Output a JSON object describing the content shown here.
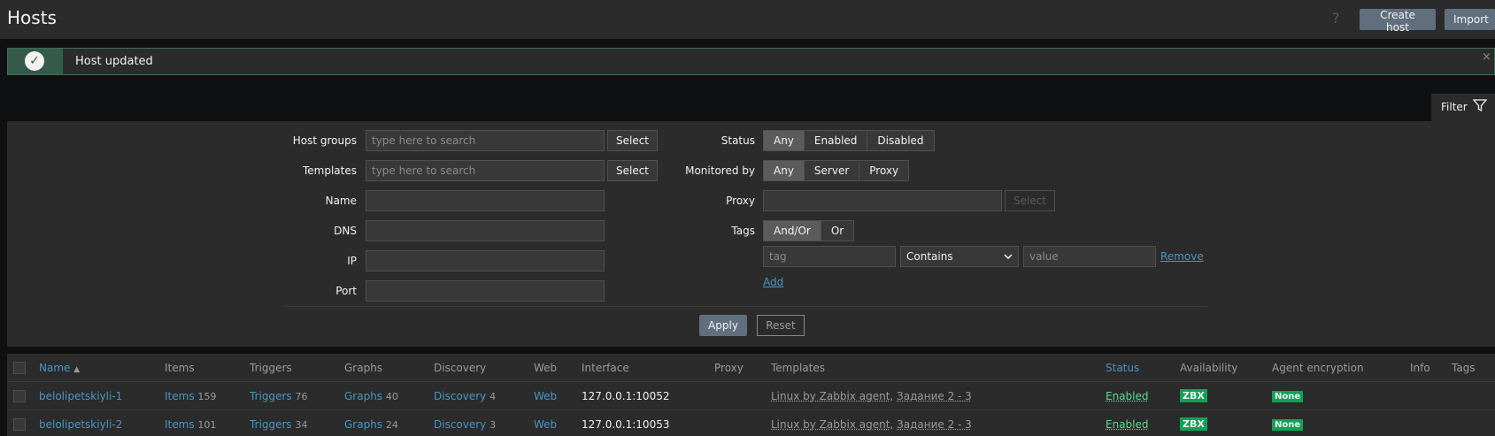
{
  "header": {
    "title": "Hosts",
    "help": "?",
    "create_host": "Create host",
    "import": "Import"
  },
  "message": {
    "text": "Host updated",
    "close": "×"
  },
  "filter": {
    "tab_label": "Filter",
    "host_groups": {
      "label": "Host groups",
      "placeholder": "type here to search",
      "button": "Select"
    },
    "templates": {
      "label": "Templates",
      "placeholder": "type here to search",
      "button": "Select"
    },
    "name_label": "Name",
    "dns_label": "DNS",
    "ip_label": "IP",
    "port_label": "Port",
    "status": {
      "label": "Status",
      "options": [
        "Any",
        "Enabled",
        "Disabled"
      ],
      "selected": "Any"
    },
    "monitored_by": {
      "label": "Monitored by",
      "options": [
        "Any",
        "Server",
        "Proxy"
      ],
      "selected": "Any"
    },
    "proxy": {
      "label": "Proxy",
      "button": "Select"
    },
    "tags": {
      "label": "Tags",
      "options": [
        "And/Or",
        "Or"
      ],
      "selected": "And/Or",
      "tag_placeholder": "tag",
      "operator": "Contains",
      "value_placeholder": "value",
      "remove": "Remove",
      "add": "Add"
    },
    "apply": "Apply",
    "reset": "Reset"
  },
  "table": {
    "columns": [
      "Name",
      "Items",
      "Triggers",
      "Graphs",
      "Discovery",
      "Web",
      "Interface",
      "Proxy",
      "Templates",
      "Status",
      "Availability",
      "Agent encryption",
      "Info",
      "Tags"
    ],
    "sort_arrow": "▲",
    "rows": [
      {
        "name": "belolipetskiyli-1",
        "items": "Items",
        "items_count": "159",
        "triggers": "Triggers",
        "triggers_count": "76",
        "graphs": "Graphs",
        "graphs_count": "40",
        "discovery": "Discovery",
        "discovery_count": "4",
        "web": "Web",
        "interface": "127.0.0.1:10052",
        "template1": "Linux by Zabbix agent",
        "template2": "Задание 2 - 3",
        "status": "Enabled",
        "availability": "ZBX",
        "encryption": "None"
      },
      {
        "name": "belolipetskiyli-2",
        "items": "Items",
        "items_count": "101",
        "triggers": "Triggers",
        "triggers_count": "34",
        "graphs": "Graphs",
        "graphs_count": "24",
        "discovery": "Discovery",
        "discovery_count": "3",
        "web": "Web",
        "interface": "127.0.0.1:10053",
        "template1": "Linux by Zabbix agent",
        "template2": "Задание 2 - 3",
        "status": "Enabled",
        "availability": "ZBX",
        "encryption": "None"
      }
    ]
  },
  "colors": {
    "accent_link": "#4796c4",
    "success": "#0ea257",
    "enabled_text": "#59db8f"
  }
}
